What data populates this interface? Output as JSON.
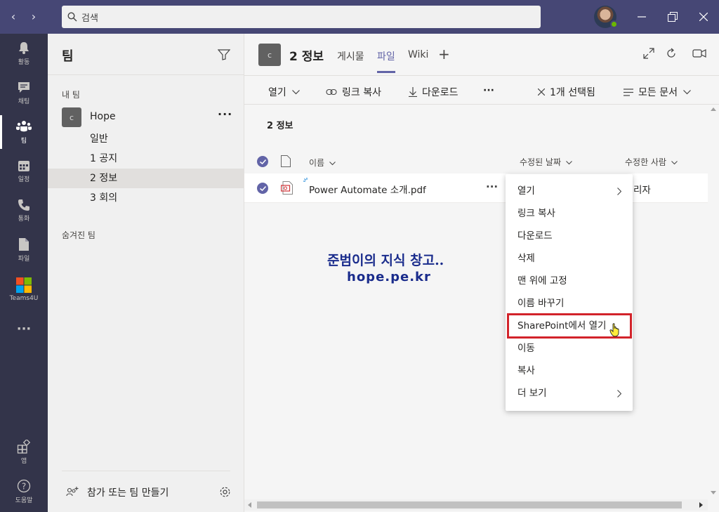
{
  "window": {
    "search_placeholder": "검색",
    "back": "‹",
    "forward": "›"
  },
  "rail": {
    "items": [
      {
        "label": "활동",
        "icon": "bell-icon"
      },
      {
        "label": "채팅",
        "icon": "chat-icon"
      },
      {
        "label": "팀",
        "icon": "teams-icon",
        "active": true
      },
      {
        "label": "일정",
        "icon": "calendar-icon"
      },
      {
        "label": "통화",
        "icon": "phone-icon"
      },
      {
        "label": "파일",
        "icon": "file-icon"
      },
      {
        "label": "Teams4U",
        "icon": "teams4u-icon"
      },
      {
        "label": "···",
        "icon": "more-apps-icon"
      },
      {
        "label": "앱",
        "icon": "apps-icon"
      },
      {
        "label": "도움말",
        "icon": "help-icon"
      }
    ]
  },
  "panel": {
    "title": "팀",
    "my_teams": "내 팀",
    "team": {
      "avatar": "c",
      "name": "Hope",
      "more": "···"
    },
    "channels": [
      "일반",
      "1 공지",
      "2 정보",
      "3 회의"
    ],
    "hidden_teams": "숨겨진 팀",
    "join": "참가 또는 팀 만들기"
  },
  "header": {
    "avatar": "c",
    "title": "2 정보",
    "tabs": [
      "게시물",
      "파일",
      "Wiki"
    ],
    "active_tab": "파일",
    "add_tab": "+"
  },
  "commands": {
    "open": "열기",
    "copy_link": "링크 복사",
    "download": "다운로드",
    "more": "···",
    "selected": "1개 선택됨",
    "all_docs": "모든 문서"
  },
  "breadcrumb": "2 정보",
  "list": {
    "col_name": "이름",
    "col_modified": "수정된 날짜",
    "col_modified_by": "수정한 사람",
    "file_name": "Power Automate 소개.pdf",
    "file_more": "···",
    "modified_by_partial": "리자"
  },
  "watermark": {
    "line1": "준범이의 지식 창고..",
    "line2": "hope.pe.kr"
  },
  "context_menu": {
    "items": [
      {
        "label": "열기",
        "submenu": true
      },
      {
        "label": "링크 복사"
      },
      {
        "label": "다운로드"
      },
      {
        "label": "삭제"
      },
      {
        "label": "맨 위에 고정"
      },
      {
        "label": "이름 바꾸기"
      },
      {
        "label": "SharePoint에서 열기",
        "highlighted": true
      },
      {
        "label": "이동"
      },
      {
        "label": "복사"
      },
      {
        "label": "더 보기",
        "submenu": true
      }
    ]
  },
  "colors": {
    "accent": "#6264a7",
    "titlebar": "#464775",
    "rail": "#33344a",
    "highlight_box": "#d2232a"
  }
}
